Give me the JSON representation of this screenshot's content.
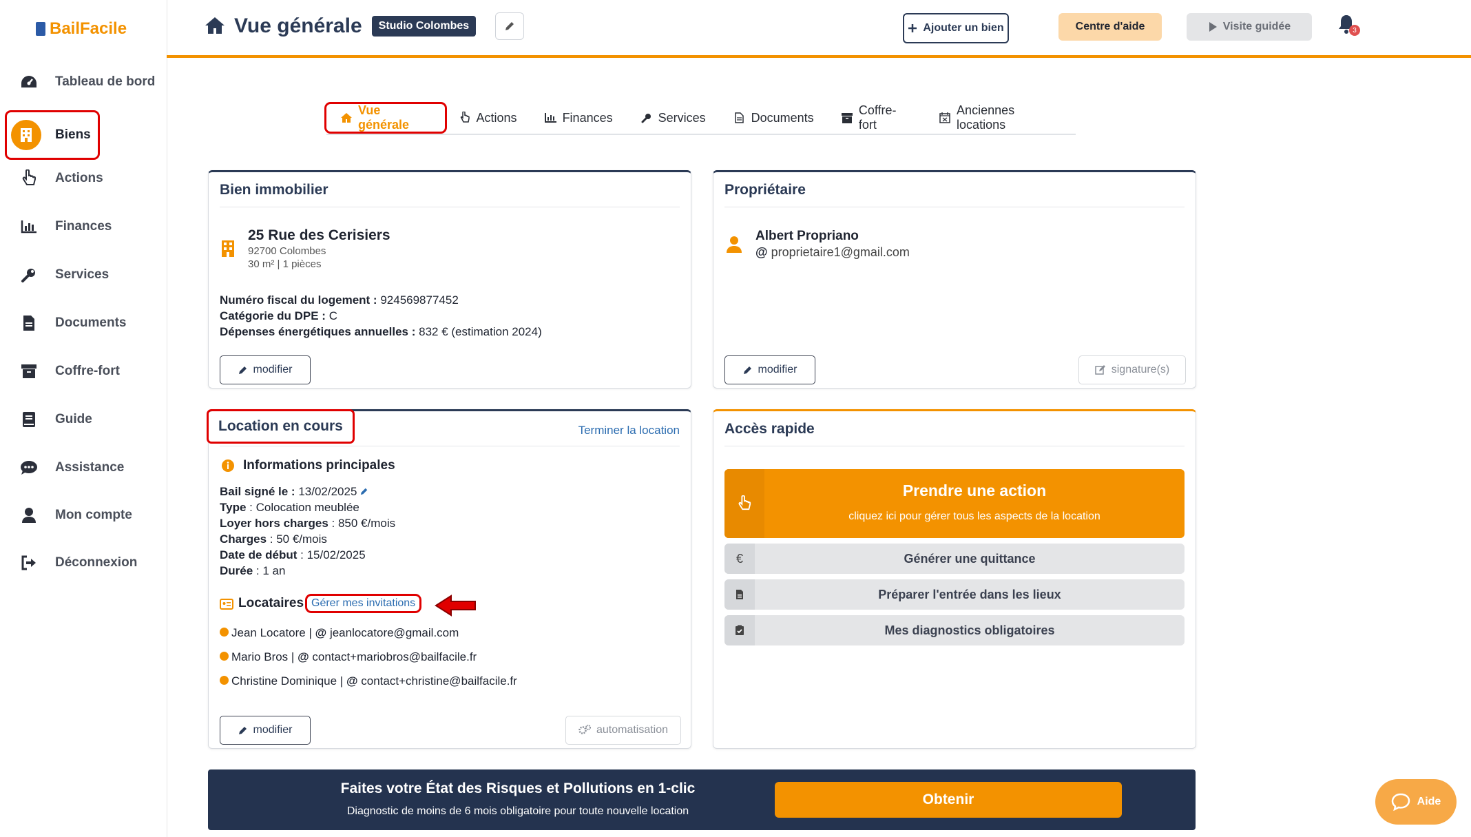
{
  "app": {
    "logo_text": "BailFacile"
  },
  "sidebar": {
    "items": [
      {
        "label": "Tableau de bord",
        "icon": "dashboard-gauge-icon"
      },
      {
        "label": "Biens",
        "icon": "building-icon",
        "active": true
      },
      {
        "label": "Actions",
        "icon": "hand-pointer-icon"
      },
      {
        "label": "Finances",
        "icon": "bar-chart-icon"
      },
      {
        "label": "Services",
        "icon": "wrench-icon"
      },
      {
        "label": "Documents",
        "icon": "document-icon"
      },
      {
        "label": "Coffre-fort",
        "icon": "archive-box-icon"
      },
      {
        "label": "Guide",
        "icon": "book-icon"
      },
      {
        "label": "Assistance",
        "icon": "chat-bubble-icon"
      },
      {
        "label": "Mon compte",
        "icon": "user-icon"
      },
      {
        "label": "Déconnexion",
        "icon": "sign-out-icon"
      }
    ]
  },
  "header": {
    "title": "Vue générale",
    "property_badge": "Studio Colombes",
    "add_property": "Ajouter un bien",
    "help_center": "Centre d'aide",
    "guided_tour": "Visite guidée",
    "notifications_count": "3"
  },
  "tabs": [
    {
      "label": "Vue générale",
      "icon": "home-icon",
      "active": true
    },
    {
      "label": "Actions",
      "icon": "hand-pointer-icon"
    },
    {
      "label": "Finances",
      "icon": "bar-chart-icon"
    },
    {
      "label": "Services",
      "icon": "wrench-icon"
    },
    {
      "label": "Documents",
      "icon": "document-icon"
    },
    {
      "label": "Coffre-fort",
      "icon": "archive-box-icon"
    },
    {
      "label": "Anciennes locations",
      "icon": "calendar-x-icon"
    }
  ],
  "bien": {
    "title": "Bien immobilier",
    "address": "25 Rue des Cerisiers",
    "city": "92700 Colombes",
    "size": "30 m² | 1 pièces",
    "fiscal_label": "Numéro fiscal du logement :",
    "fiscal_value": "924569877452",
    "dpe_label": "Catégorie du DPE :",
    "dpe_value": "C",
    "energy_label": "Dépenses énergétiques annuelles :",
    "energy_value": "832 € (estimation 2024)",
    "modify": "modifier"
  },
  "owner": {
    "title": "Propriétaire",
    "name": "Albert Propriano",
    "email": "proprietaire1@gmail.com",
    "modify": "modifier",
    "signatures": "signature(s)"
  },
  "location": {
    "title": "Location en cours",
    "end_link": "Terminer la location",
    "info_title": "Informations principales",
    "bail_label": "Bail signé le :",
    "bail_value": "13/02/2025",
    "type_label": "Type",
    "type_value": ": Colocation meublée",
    "rent_label": "Loyer hors charges",
    "rent_value": ": 850 €/mois",
    "charges_label": "Charges",
    "charges_value": ": 50 €/mois",
    "start_label": "Date de début",
    "start_value": ": 15/02/2025",
    "duration_label": "Durée",
    "duration_value": ": 1 an",
    "tenants_title": "Locataires",
    "invitations_link": "Gérer mes invitations",
    "tenants": [
      {
        "name": "Jean Locatore",
        "email": "jeanlocatore@gmail.com"
      },
      {
        "name": "Mario Bros",
        "email": "contact+mariobros@bailfacile.fr"
      },
      {
        "name": "Christine Dominique",
        "email": "contact+christine@bailfacile.fr"
      }
    ],
    "modify": "modifier",
    "automation": "automatisation"
  },
  "quick_access": {
    "title": "Accès rapide",
    "main_title": "Prendre une action",
    "main_subtitle": "cliquez ici pour gérer tous les aspects de la location",
    "rows": [
      {
        "label": "Générer une quittance",
        "icon": "euro-icon"
      },
      {
        "label": "Préparer l'entrée dans les lieux",
        "icon": "document-icon"
      },
      {
        "label": "Mes diagnostics obligatoires",
        "icon": "clipboard-check-icon"
      }
    ]
  },
  "banner": {
    "title": "Faites votre État des Risques et Pollutions en 1-clic",
    "subtitle": "Diagnostic de moins de 6 mois obligatoire pour toute nouvelle location",
    "cta": "Obtenir"
  },
  "help_widget": {
    "label": "Aide"
  },
  "colors": {
    "accent": "#f39200",
    "navy": "#2b3a55",
    "annotation": "#e00000"
  }
}
